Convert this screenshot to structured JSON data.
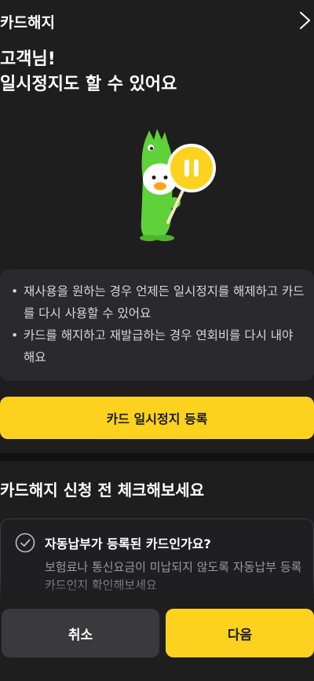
{
  "header": {
    "title": "카드해지",
    "close_icon": "close-icon"
  },
  "greeting": {
    "line1": "고객님!",
    "line2": "일시정지도 할 수 있어요"
  },
  "illustration": {
    "icon": "mascot-pause-sign",
    "accent": "#fcd21e",
    "body_color": "#5fd13a"
  },
  "info": {
    "items": [
      "재사용을 원하는 경우 언제든 일시정지를 해제하고 카드를 다시 사용할 수 있어요",
      "카드를 해지하고 재발급하는 경우 연회비를 다시 내야 해요"
    ]
  },
  "primary_button": {
    "label": "카드 일시정지 등록",
    "color": "#fcd21e"
  },
  "section": {
    "title": "카드해지 신청 전 체크해보세요"
  },
  "check": {
    "icon": "check-circle-icon",
    "title": "자동납부가 등록된 카드인가요?",
    "description": "보험료나 통신요금이 미납되지 않도록 자동납부 등록카드인지 확인해보세요"
  },
  "footer": {
    "cancel_label": "취소",
    "next_label": "다음"
  }
}
